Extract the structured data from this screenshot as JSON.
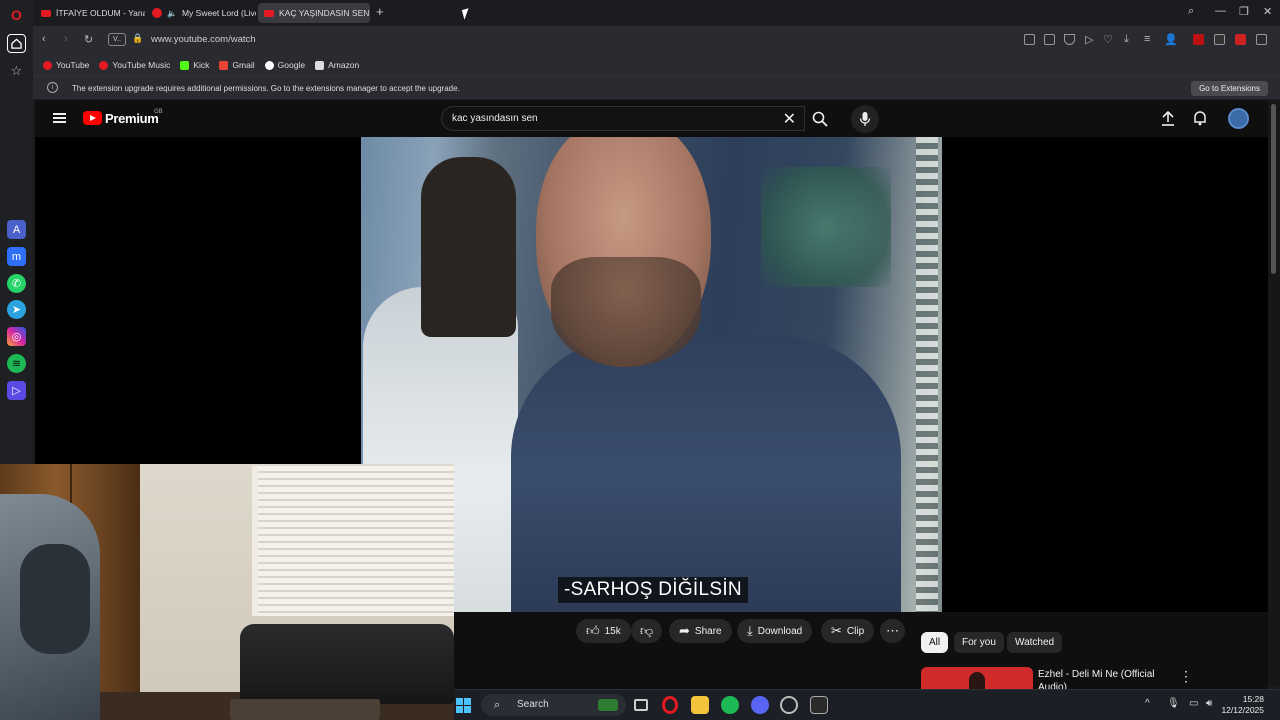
{
  "browser": {
    "tabs": [
      {
        "label": "İTFAİYE OLDUM - Yanan v"
      },
      {
        "label": "My Sweet Lord (Live) -"
      },
      {
        "label": "KAÇ YAŞINDASIN SEN? - "
      }
    ],
    "url": "www.youtube.com/watch",
    "vpn_badge": "V..",
    "bookmarks": [
      {
        "label": "YouTube",
        "color": "#e41b22"
      },
      {
        "label": "YouTube Music",
        "color": "#e41b22"
      },
      {
        "label": "Kick",
        "color": "#53fc18"
      },
      {
        "label": "Gmail",
        "color": "#ea4335"
      },
      {
        "label": "Google",
        "color": "#4285f4"
      },
      {
        "label": "Amazon",
        "color": "#dddddd"
      }
    ],
    "notification": {
      "text": "The extension upgrade requires additional permissions. Go to the extensions manager to accept the upgrade.",
      "button": "Go to Extensions"
    }
  },
  "youtube": {
    "logo_text": "Premium",
    "region": "GB",
    "search_value": "kac yasındasın sen",
    "video_subtitle": "-SARHOŞ DİĞİLSİN",
    "actions": {
      "like_count": "15k",
      "share": "Share",
      "download": "Download",
      "clip": "Clip"
    },
    "chips": [
      "All",
      "For you",
      "Watched"
    ],
    "recommended": [
      {
        "title": "Ezhel - Deli Mi Ne (Official Audio)"
      }
    ]
  },
  "taskbar": {
    "search_label": "Search",
    "time": "15:28",
    "date": "12/12/2025"
  },
  "colors": {
    "accent": "#ff0000",
    "opera": "#e41b22"
  }
}
